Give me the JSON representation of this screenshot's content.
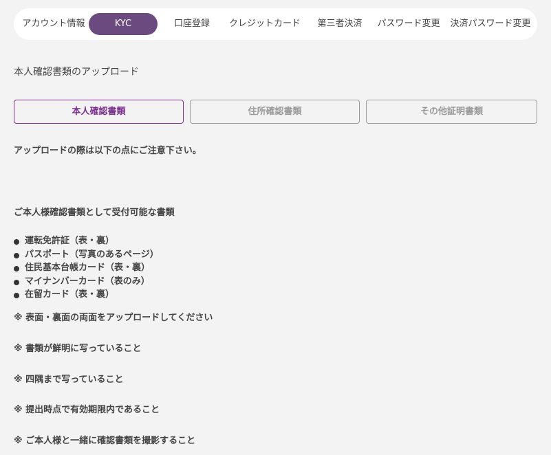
{
  "nav": {
    "items": [
      {
        "label": "アカウント情報"
      },
      {
        "label": "KYC"
      },
      {
        "label": "口座登録"
      },
      {
        "label": "クレジットカード"
      },
      {
        "label": "第三者決済"
      },
      {
        "label": "パスワード変更"
      },
      {
        "label": "決済パスワード変更"
      }
    ],
    "active_index": 1
  },
  "page": {
    "title": "本人確認書類のアップロード"
  },
  "doc_tabs": [
    {
      "label": "本人確認書類"
    },
    {
      "label": "住所確認書類"
    },
    {
      "label": "その他証明書類"
    }
  ],
  "content": {
    "notice": "アップロードの際は以下の点にご注意下さい。",
    "accepted_heading": "ご本人様確認書類として受付可能な書類",
    "accepted_docs": [
      "運転免許証（表・裏）",
      "パスポート（写真のあるページ）",
      "住民基本台帳カード（表・裏）",
      "マイナンバーカード（表のみ）",
      "在留カード（表・裏）"
    ],
    "notes": [
      "※ 表面・裏面の両面をアップロードしてください",
      "※ 書類が鮮明に写っていること",
      "※ 四隅まで写っていること",
      "※ 提出時点で有効期限内であること",
      "※ ご本人様と一緒に確認書類を撮影すること"
    ]
  },
  "colors": {
    "background": "#f3f3f3",
    "nav_active": "#6a4a7f",
    "tab_active": "#7a2f8e",
    "tab_inactive": "#9a9a9a",
    "text": "#444444"
  }
}
